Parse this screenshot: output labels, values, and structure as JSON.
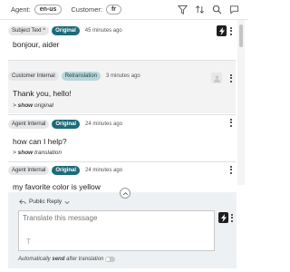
{
  "topbar": {
    "agent_label": "Agent:",
    "agent_lang": "en-us",
    "customer_label": "Customer:",
    "customer_lang": "fr",
    "icons": [
      "filter-icon",
      "sort-icon",
      "search-icon",
      "chat-icon"
    ]
  },
  "messages": [
    {
      "tags": [
        "Subject Text ^",
        "Original"
      ],
      "time": "45 minutes ago",
      "text": "bonjour, aider"
    },
    {
      "tags": [
        "Customer Internal",
        "Retranslation"
      ],
      "time": "3 minutes ago",
      "text": "Thank you, hello!",
      "link_prefix": "> ",
      "link_action": "show",
      "link_target": "original"
    },
    {
      "tags": [
        "Agent Internal",
        "Original"
      ],
      "time": "24 minutes ago",
      "text": "how can I help?",
      "link_prefix": "> ",
      "link_action": "show",
      "link_target": "translation"
    },
    {
      "tags": [
        "Agent Internal",
        "Original"
      ],
      "time": "24 minutes ago",
      "text": "my favorite color is yellow"
    }
  ],
  "reply": {
    "mode_label": "Public Reply",
    "placeholder": "Translate this message",
    "cursor_glyph": "T",
    "auto_prefix": "Automatically ",
    "auto_bold": "send",
    "auto_suffix": " after translation"
  },
  "colors": {
    "accent_teal": "#1d6b7a",
    "light_teal": "#b8d6dc"
  }
}
